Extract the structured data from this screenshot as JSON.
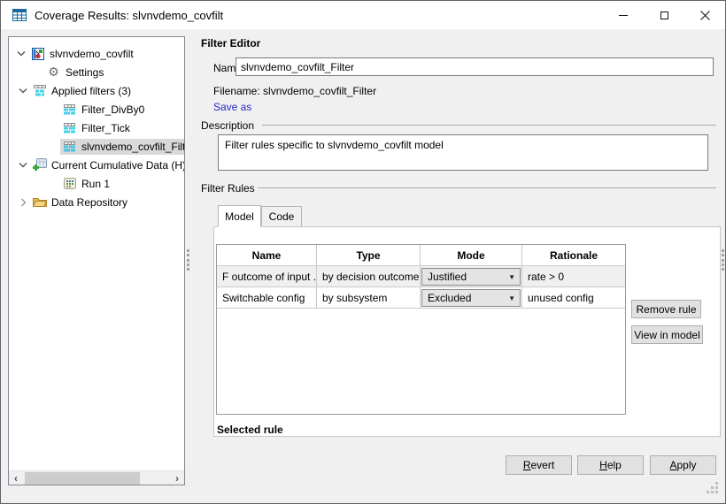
{
  "window": {
    "title": "Coverage Results: slvnvdemo_covfilt"
  },
  "tree": {
    "items": [
      {
        "label": "slvnvdemo_covfilt",
        "icon": "model-icon",
        "level": 1,
        "state": "expanded"
      },
      {
        "label": "Settings",
        "icon": "gear-icon",
        "level": 2,
        "state": "leaf"
      },
      {
        "label": "Applied filters (3)",
        "icon": "filter-table-icon",
        "level": 2,
        "state": "expanded"
      },
      {
        "label": "Filter_DivBy0",
        "icon": "filter-icon",
        "level": 3,
        "state": "leaf"
      },
      {
        "label": "Filter_Tick",
        "icon": "filter-icon",
        "level": 3,
        "state": "leaf"
      },
      {
        "label": "slvnvdemo_covfilt_Filter",
        "icon": "filter-icon",
        "level": 3,
        "state": "leaf",
        "selected": true
      },
      {
        "label": "Current Cumulative Data (H)",
        "icon": "cumulative-data-icon",
        "level": 2,
        "state": "expanded"
      },
      {
        "label": "Run 1",
        "icon": "run-icon",
        "level": 3,
        "state": "leaf"
      },
      {
        "label": "Data Repository",
        "icon": "folder-icon",
        "level": 2,
        "state": "collapsed"
      }
    ]
  },
  "editor": {
    "heading": "Filter Editor",
    "name_label": "Name",
    "name_value": "slvnvdemo_covfilt_Filter",
    "filename_text": "Filename: slvnvdemo_covfilt_Filter",
    "save_as": "Save as",
    "description_label": "Description",
    "description_value": "Filter rules specific to slvnvdemo_covfilt model",
    "filter_rules_label": "Filter Rules",
    "tabs": [
      {
        "label": "Model",
        "active": true
      },
      {
        "label": "Code",
        "active": false
      }
    ],
    "table": {
      "headers": [
        "Name",
        "Type",
        "Mode",
        "Rationale"
      ],
      "rows": [
        {
          "name": "F outcome of input ...",
          "type": "by decision outcome",
          "mode": "Justified",
          "rationale": "rate > 0",
          "selected": true
        },
        {
          "name": "Switchable config",
          "type": "by subsystem",
          "mode": "Excluded",
          "rationale": "unused config",
          "selected": false
        }
      ]
    },
    "side_buttons": {
      "remove_rule": "Remove rule",
      "view_in_model": "View in model"
    },
    "selected_rule_label": "Selected rule"
  },
  "footer": {
    "revert": "Revert",
    "help": "Help",
    "apply": "Apply"
  },
  "icons": {
    "window-icon": "blue table grid",
    "minimize-icon": "horizontal bar",
    "maximize-icon": "square outline",
    "close-icon": "x cross",
    "chevron-down-icon": "⌄",
    "chevron-right-icon": "›",
    "model-icon": "simulink model block",
    "gear-icon": "⚙",
    "filter-icon": "cyan segmented rows",
    "cumulative-data-icon": "grid with green plus",
    "run-icon": "small data grid",
    "folder-icon": "yellow folder",
    "combo-arrow-icon": "▼",
    "scroll-left-icon": "‹",
    "scroll-right-icon": "›"
  },
  "colors": {
    "dialog_bg": "#f0f0f0",
    "titlebar_bg": "#ffffff",
    "selection_gray": "#d9d9d9",
    "link_blue": "#2626c9",
    "filter_cyan": "#45d1e8",
    "button_bg": "#e1e1e1",
    "button_border": "#adadad"
  }
}
